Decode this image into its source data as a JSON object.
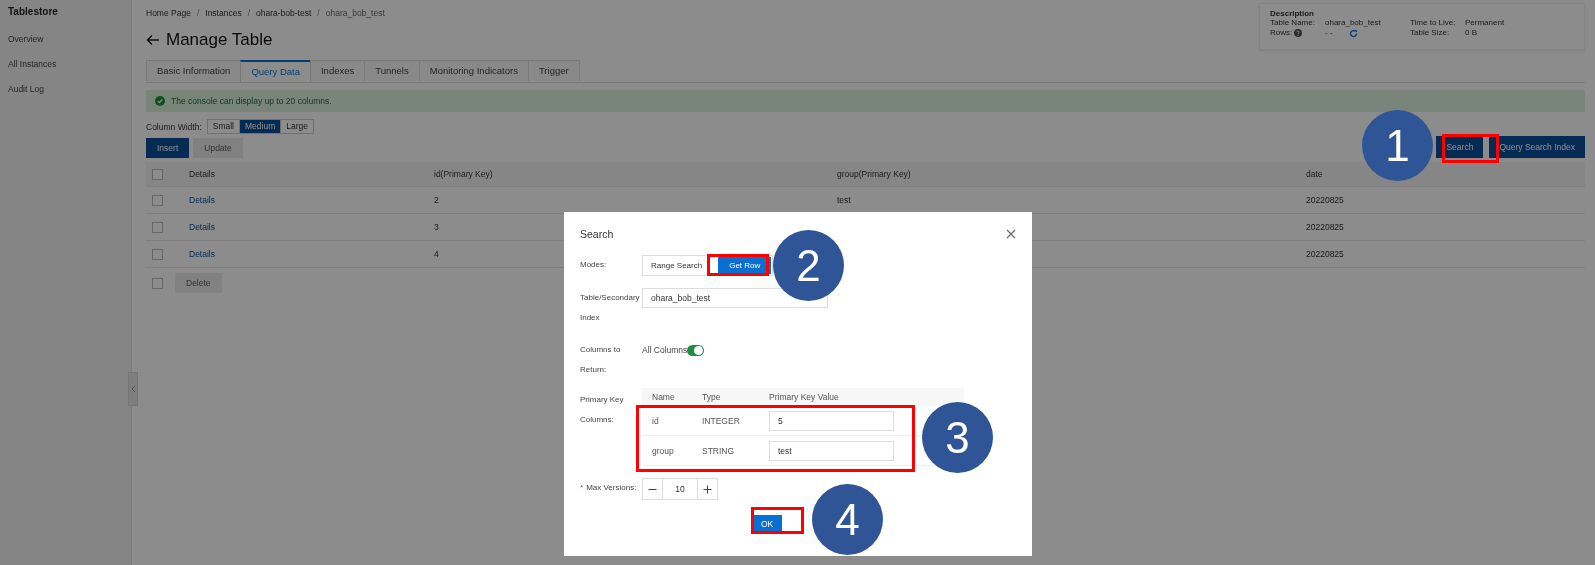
{
  "sidebar": {
    "title": "Tablestore",
    "items": [
      {
        "label": "Overview",
        "selected": false
      },
      {
        "label": "All Instances",
        "selected": false
      },
      {
        "label": "Audit Log",
        "selected": false
      }
    ]
  },
  "breadcrumb": {
    "separator": "/",
    "items": [
      "Home Page",
      "Instances",
      "ohara-bob-test",
      "ohara_bob_test"
    ]
  },
  "page_title": "Manage Table",
  "description": {
    "heading": "Description",
    "fields": [
      {
        "label": "Table Name:",
        "value": "ohara_bob_test",
        "kind": "text"
      },
      {
        "label": "Time to Live:",
        "value": "Permanent",
        "kind": "text"
      },
      {
        "label": "Rows:",
        "value": "- -",
        "kind": "help-refresh"
      },
      {
        "label": "Table Size:",
        "value": "0 B",
        "kind": "text"
      }
    ]
  },
  "tabs": [
    {
      "label": "Basic Information",
      "selected": false
    },
    {
      "label": "Query Data",
      "selected": true
    },
    {
      "label": "Indexes",
      "selected": false
    },
    {
      "label": "Tunnels",
      "selected": false
    },
    {
      "label": "Monitoring Indicators",
      "selected": false
    },
    {
      "label": "Trigger",
      "selected": false
    }
  ],
  "notice": "The console can display up to 20 columns.",
  "column_width": {
    "label": "Column Width:",
    "options": [
      {
        "label": "Small",
        "selected": false
      },
      {
        "label": "Medium",
        "selected": true
      },
      {
        "label": "Large",
        "selected": false
      }
    ]
  },
  "actions": [
    {
      "label": "Insert",
      "disabled": false
    },
    {
      "label": "Update",
      "disabled": true
    }
  ],
  "search_actions": [
    {
      "label": "Search"
    },
    {
      "label": "Query Search Index"
    }
  ],
  "table": {
    "header_checked": false,
    "columns": [
      "Details",
      "id(Primary Key)",
      "group(Primary Key)",
      "date"
    ],
    "rows": [
      {
        "checked": false,
        "link": "Details",
        "id": "2",
        "group": "test",
        "date": "20220825"
      },
      {
        "checked": false,
        "link": "Details",
        "id": "3",
        "date": "20220825"
      },
      {
        "checked": false,
        "link": "Details",
        "id": "4",
        "date": "20220825"
      }
    ],
    "footer": {
      "checked": false,
      "button": "Delete",
      "disabled": true
    }
  },
  "modal": {
    "title": "Search",
    "modes": {
      "label": "Modes:",
      "options": [
        {
          "label": "Range Search",
          "selected": false
        },
        {
          "label": "Get Row",
          "selected": true
        }
      ]
    },
    "table_field": {
      "label": "Table/Secondary Index",
      "value": "ohara_bob_test"
    },
    "columns_to_return": {
      "label": "Columns to Return:",
      "option": "All Columns",
      "on": true
    },
    "primary_keys": {
      "label": "Primary Key Columns:",
      "columns": [
        "Name",
        "Type",
        "Primary Key Value"
      ],
      "rows": [
        {
          "name": "id",
          "type": "INTEGER",
          "value": "5"
        },
        {
          "name": "group",
          "type": "STRING",
          "value": "test"
        }
      ]
    },
    "max_versions": {
      "required_mark": "*",
      "label": "Max Versions:",
      "value": "10"
    },
    "ok": "OK"
  },
  "annotations": [
    "1",
    "2",
    "3",
    "4"
  ]
}
